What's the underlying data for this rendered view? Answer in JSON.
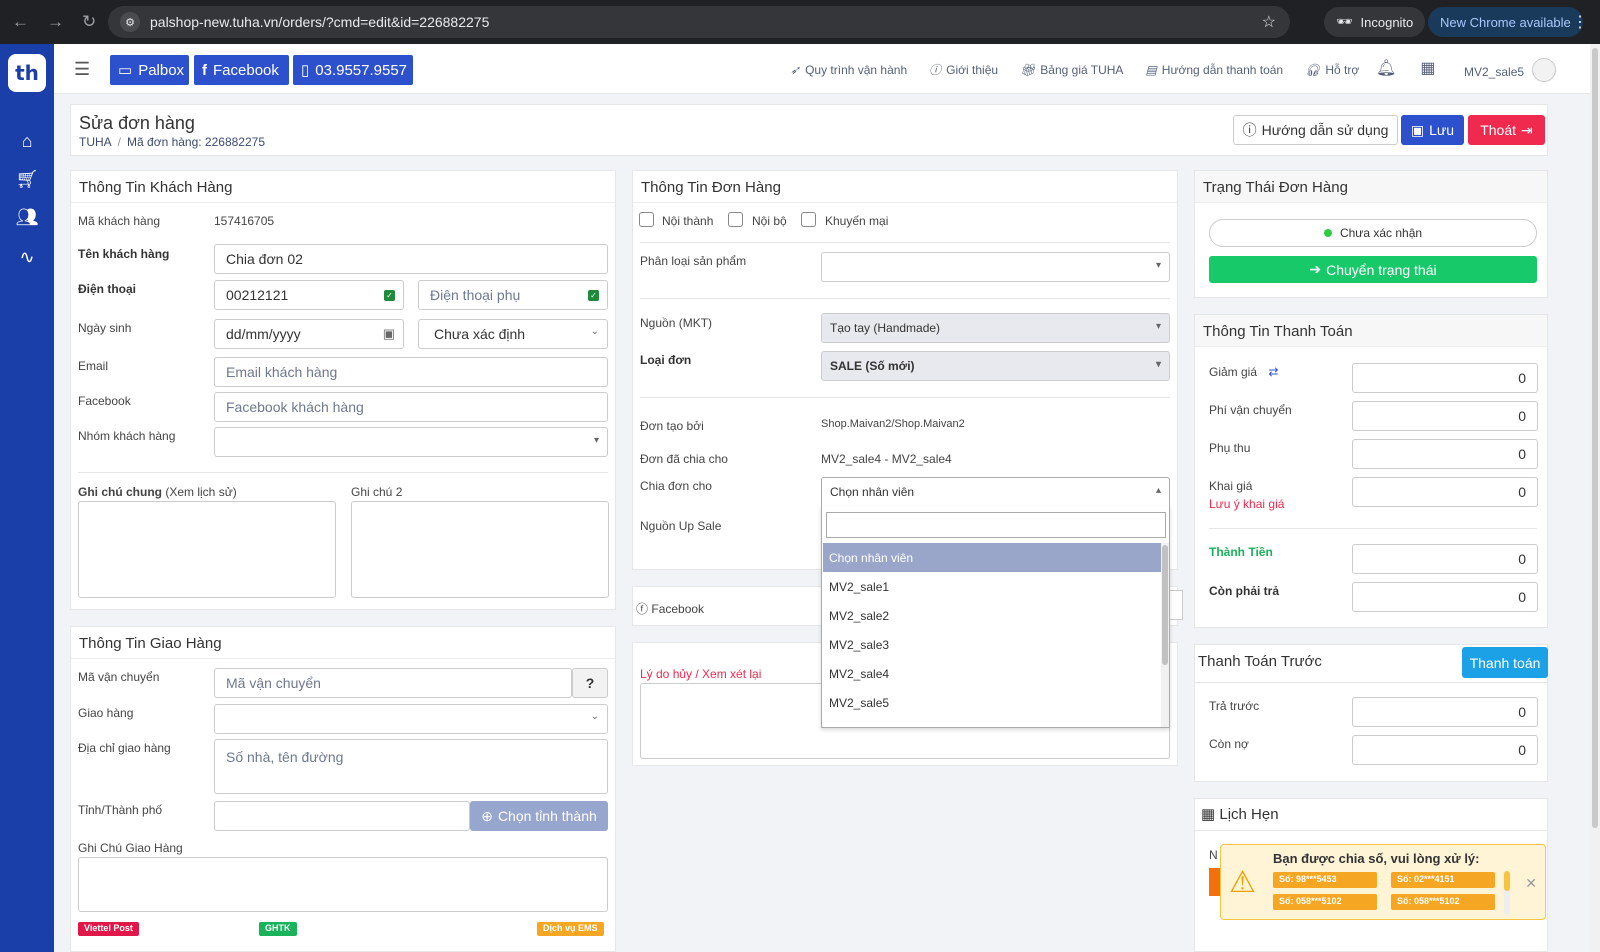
{
  "browser": {
    "url": "palshop-new.tuha.vn/orders/?cmd=edit&id=226882275",
    "incognito": "Incognito",
    "new_chrome": "New Chrome available"
  },
  "topbar": {
    "palbox": "Palbox",
    "facebook": "Facebook",
    "phone": "03.9557.9557",
    "links": [
      "Quy trình vận hành",
      "Giới thiệu",
      "Bảng giá TUHA",
      "Hướng dẫn thanh toán",
      "Hỗ trợ"
    ],
    "user": "MV2_sale5"
  },
  "logo": "th",
  "page": {
    "title": "Sửa đơn hàng",
    "crumb_root": "TUHA",
    "crumb_current": "Mã đơn hàng: 226882275",
    "help_btn": "Hướng dẫn sử dụng",
    "save_btn": "Lưu",
    "exit_btn": "Thoát"
  },
  "customer": {
    "title": "Thông Tin Khách Hàng",
    "id_label": "Mã khách hàng",
    "id_value": "157416705",
    "name_label": "Tên khách hàng",
    "name_value": "Chia đơn 02",
    "phone_label": "Điện thoại",
    "phone_value": "00212121",
    "phone2_placeholder": "Điện thoại phụ",
    "dob_label": "Ngày sinh",
    "dob_value": "dd/mm/yyyy",
    "gender_value": "Chưa xác định",
    "email_label": "Email",
    "email_placeholder": "Email khách hàng",
    "facebook_label": "Facebook",
    "facebook_placeholder": "Facebook khách hàng",
    "group_label": "Nhóm khách hàng",
    "note1_label": "Ghi chú chung",
    "note1_history": "(Xem lịch sử)",
    "note2_label": "Ghi chú 2"
  },
  "shipping": {
    "title": "Thông Tin Giao Hàng",
    "code_label": "Mã vận chuyển",
    "code_placeholder": "Mã vận chuyển",
    "delivery_label": "Giao hàng",
    "address_label": "Địa chỉ giao hàng",
    "address_placeholder": "Số nhà, tên đường",
    "city_label": "Tỉnh/Thành phố",
    "city_btn": "Chọn tỉnh thành",
    "note_label": "Ghi Chú Giao Hàng",
    "carriers": [
      "Viettel Post",
      "GHTK",
      "Dịch vụ EMS"
    ]
  },
  "order": {
    "title": "Thông Tin Đơn Hàng",
    "chk": [
      "Nội thành",
      "Nội bộ",
      "Khuyến mại"
    ],
    "category_label": "Phân loại sản phẩm",
    "source_label": "Nguồn (MKT)",
    "source_value": "Tạo tay (Handmade)",
    "type_label": "Loại đơn",
    "type_value": "SALE (Số mới)",
    "created_label": "Đơn tạo bởi",
    "created_value": "Shop.Maivan2/Shop.Maivan2",
    "split_label": "Đơn đã chia cho",
    "split_value": "MV2_sale4 - MV2_sale4",
    "assign_label": "Chia đơn cho",
    "assign_value": "Chọn nhân viên",
    "upsale_label": "Nguồn Up Sale",
    "facebook_label": "Facebook",
    "cancel_label": "Lý do hủy / Xem xét lại",
    "options": [
      "Chọn nhân viên",
      "MV2_sale1",
      "MV2_sale2",
      "MV2_sale3",
      "MV2_sale4",
      "MV2_sale5"
    ]
  },
  "status": {
    "title": "Trạng Thái Đơn Hàng",
    "current": "Chưa xác nhận",
    "change_btn": "Chuyển trạng thái",
    "dot_color": "#2ecc40"
  },
  "payment": {
    "title": "Thông Tin Thanh Toán",
    "discount_label": "Giảm giá",
    "discount": "0",
    "ship_label": "Phí vận chuyển",
    "ship": "0",
    "extra_label": "Phụ thu",
    "extra": "0",
    "declared_label": "Khai giá",
    "declared_note": "Lưu ý khai giá",
    "declared": "0",
    "total_label": "Thành Tiền",
    "total": "0",
    "remain_label": "Còn phải trả",
    "remain": "0"
  },
  "prepay": {
    "title": "Thanh Toán Trước",
    "pay_btn": "Thanh toán",
    "prepaid_label": "Trả trước",
    "prepaid": "0",
    "debt_label": "Còn nợ",
    "debt": "0"
  },
  "schedule": {
    "title": "Lịch Hẹn",
    "partial": "N"
  },
  "notification": {
    "title": "Bạn được chia số, vui lòng xử lý:",
    "chips": [
      "Số: 98***5453",
      "Số: 02***4151",
      "Số: 058***5102",
      "Số: 058***5102"
    ]
  },
  "colors": {
    "primary": "#2d50cc",
    "danger": "#f0294e",
    "success": "#18c96a",
    "info": "#1da1e6",
    "nav": "#1b3fa8"
  }
}
